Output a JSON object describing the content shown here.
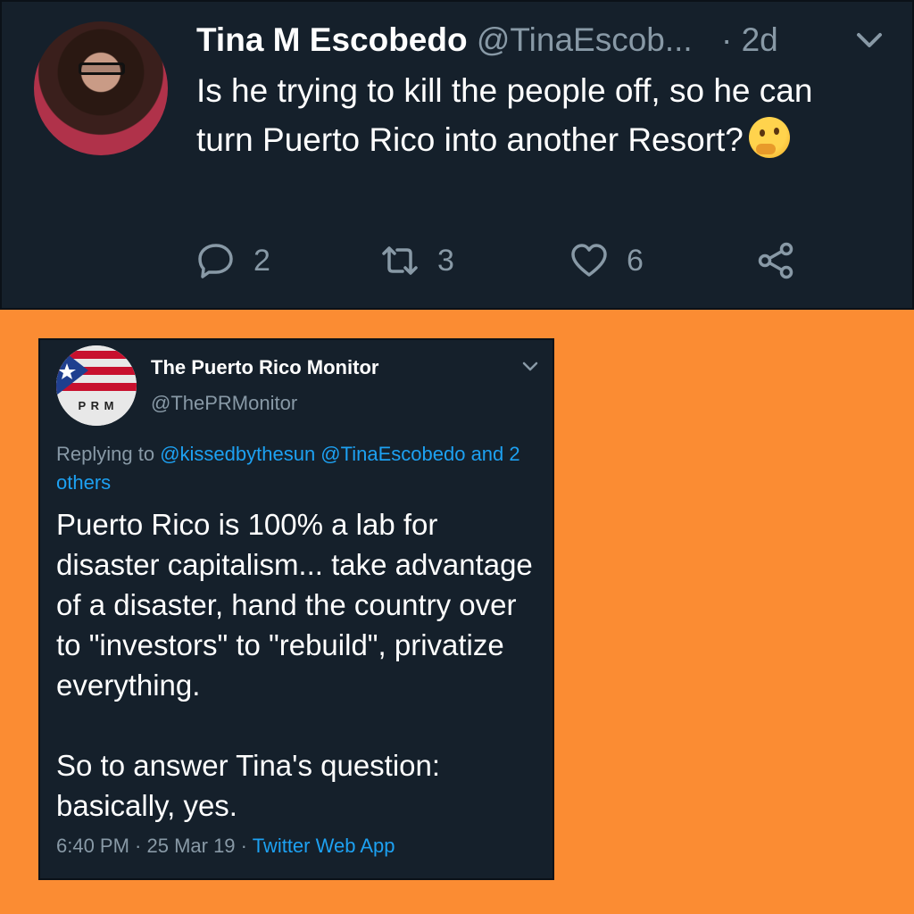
{
  "tweet1": {
    "name": "Tina M Escobedo",
    "handle": "@TinaEscob...",
    "separator": "·",
    "time": "2d",
    "text": "Is he trying to kill the people off, so he can turn Puerto Rico into another Resort?",
    "emoji": "thinking-face",
    "actions": {
      "replies": "2",
      "retweets": "3",
      "likes": "6"
    },
    "colors": {
      "background": "#15202b",
      "muted": "#8899a6",
      "text": "#ffffff"
    }
  },
  "tweet2": {
    "name": "The Puerto Rico Monitor",
    "handle": "@ThePRMonitor",
    "avatar_letters": "P R M",
    "reply_prefix": "Replying to",
    "reply_mentions": "@kissedbythesun @TinaEscobedo and 2 others",
    "text": "Puerto Rico is 100% a lab for disaster capitalism... take advantage of a disaster, hand the country over to \"investors\" to \"rebuild\", privatize everything.\n\nSo to answer Tina's question: basically, yes.",
    "timestamp": "6:40 PM · 25 Mar 19 ·",
    "source": "Twitter Web App",
    "colors": {
      "link": "#1da1f2"
    }
  },
  "page": {
    "background": "#fb8c33"
  }
}
